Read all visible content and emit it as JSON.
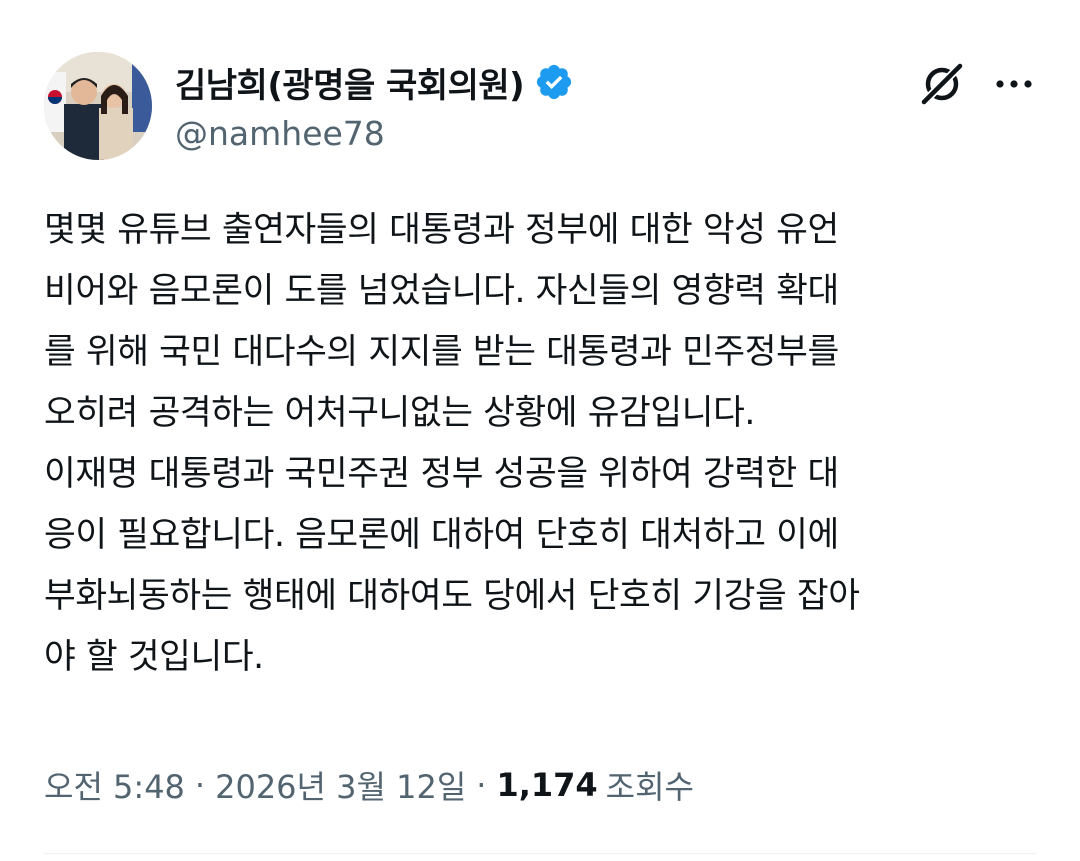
{
  "author": {
    "display_name": "김남희(광명을 국회의원)",
    "handle": "@namhee78",
    "verified": true,
    "verified_color": "#1d9bf0"
  },
  "icons": {
    "verified": "verified-badge-icon",
    "grok": "grok-icon",
    "more": "more-options-icon"
  },
  "tweet": {
    "lines": [
      "몇몇 유튜브 출연자들의 대통령과 정부에 대한 악성 유언",
      "비어와 음모론이 도를 넘었습니다. 자신들의 영향력 확대",
      "를 위해 국민 대다수의 지지를 받는 대통령과 민주정부를",
      "오히려 공격하는 어처구니없는 상황에 유감입니다.",
      "이재명 대통령과 국민주권 정부 성공을 위하여 강력한 대",
      "응이 필요합니다. 음모론에 대하여 단호히 대처하고 이에",
      "부화뇌동하는 행태에 대하여도 당에서 단호히 기강을 잡아",
      "야 할 것입니다."
    ]
  },
  "meta": {
    "time": "오전 5:48",
    "separator": "·",
    "date": "2026년 3월 12일",
    "views_count": "1,174",
    "views_label": "조회수"
  }
}
